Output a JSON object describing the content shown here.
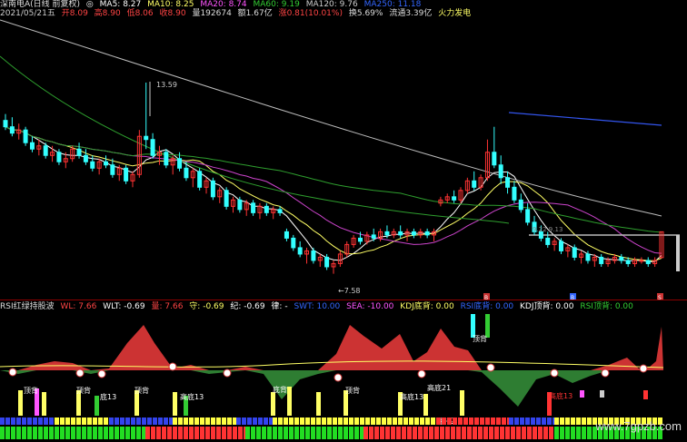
{
  "main_header": {
    "title": "深南电A(日线 前复权)",
    "ma": [
      {
        "label": "MA5: 8.27",
        "color": "#ffffff"
      },
      {
        "label": "MA10: 8.25",
        "color": "#ffff66"
      },
      {
        "label": "MA20: 8.74",
        "color": "#ff55ff"
      },
      {
        "label": "MA60: 9.19",
        "color": "#33cc33"
      },
      {
        "label": "MA120: 9.76",
        "color": "#cccccc"
      },
      {
        "label": "MA250: 11.18",
        "color": "#3366ff"
      }
    ]
  },
  "quote_line": {
    "date": "2021/05/21五",
    "open": "开8.09",
    "high": "高8.90",
    "low": "低8.06",
    "close": "收8.90",
    "volume": "量192674",
    "amount": "额1.67亿",
    "change": "涨0.81(10.01%)",
    "turnover": "换5.69%",
    "float_cap": "流通3.39亿",
    "tag": "火力发电"
  },
  "price_annotations": {
    "high_label": "13.59",
    "low_label": "7.58",
    "ref_label": "9.22 9.13"
  },
  "lower_header": {
    "items": [
      {
        "label": "RSI红绿持股波",
        "color": "#dddddd"
      },
      {
        "label": "WL: 7.66",
        "color": "#ff4444"
      },
      {
        "label": "WLT: -0.69",
        "color": "#ffffff"
      },
      {
        "label": "量: 7.66",
        "color": "#ff4444"
      },
      {
        "label": "守: -0.69",
        "color": "#ffff66"
      },
      {
        "label": "纪: -0.69",
        "color": "#ffffff"
      },
      {
        "label": "律: -",
        "color": "#ffffff"
      },
      {
        "label": "SWT: 10.00",
        "color": "#3366ff"
      },
      {
        "label": "SEA: -10.00",
        "color": "#ff55ff"
      },
      {
        "label": "KDJ底背: 0.00",
        "color": "#ffff66"
      },
      {
        "label": "RSI底背: 0.00",
        "color": "#3366ff"
      },
      {
        "label": "KDJ顶背: 0.00",
        "color": "#ffffff"
      },
      {
        "label": "RSI顶背: 0.00",
        "color": "#33cc33"
      }
    ]
  },
  "indicator_labels": {
    "ding_bei": "顶背",
    "di_bei": "底背",
    "di_13": "底13",
    "gao_di_13": "高底13",
    "gao_di_21": "高底21",
    "chi_gu": "持股",
    "marker_b": "B",
    "marker_s": "S"
  },
  "watermark": "www.7gpzb.com",
  "colors": {
    "up": "#ff3333",
    "down": "#33ffff",
    "bg": "#000000",
    "red_fill": "#cc3333",
    "green_fill": "#2e7d32"
  },
  "chart_data": {
    "type": "candlestick",
    "price_range": [
      7.0,
      15.5
    ],
    "candles": [
      [
        12.4,
        12.6,
        12.1,
        12.2
      ],
      [
        12.2,
        12.5,
        11.9,
        12.0
      ],
      [
        12.0,
        12.3,
        11.8,
        12.1
      ],
      [
        12.1,
        12.2,
        11.6,
        11.7
      ],
      [
        11.7,
        11.9,
        11.4,
        11.5
      ],
      [
        11.5,
        11.8,
        11.3,
        11.6
      ],
      [
        11.6,
        11.7,
        11.2,
        11.3
      ],
      [
        11.3,
        11.6,
        11.1,
        11.4
      ],
      [
        11.4,
        11.5,
        11.0,
        11.1
      ],
      [
        11.1,
        11.4,
        10.9,
        11.2
      ],
      [
        11.2,
        11.6,
        11.1,
        11.5
      ],
      [
        11.5,
        11.7,
        11.2,
        11.3
      ],
      [
        11.3,
        11.5,
        11.0,
        11.1
      ],
      [
        11.1,
        11.3,
        10.8,
        10.9
      ],
      [
        10.9,
        11.2,
        10.7,
        11.1
      ],
      [
        11.1,
        11.3,
        10.9,
        11.0
      ],
      [
        11.0,
        11.2,
        10.6,
        10.7
      ],
      [
        10.7,
        11.0,
        10.5,
        10.9
      ],
      [
        10.9,
        11.0,
        10.4,
        10.5
      ],
      [
        10.5,
        10.8,
        10.3,
        10.7
      ],
      [
        10.7,
        12.1,
        10.6,
        11.9
      ],
      [
        11.9,
        13.59,
        11.5,
        11.8
      ],
      [
        11.8,
        12.0,
        11.2,
        11.3
      ],
      [
        11.3,
        11.6,
        11.0,
        11.4
      ],
      [
        11.4,
        11.5,
        10.9,
        11.0
      ],
      [
        11.0,
        11.3,
        10.7,
        11.2
      ],
      [
        11.2,
        11.4,
        10.8,
        10.9
      ],
      [
        10.9,
        11.1,
        10.5,
        10.6
      ],
      [
        10.6,
        10.9,
        10.3,
        10.8
      ],
      [
        10.8,
        10.9,
        10.2,
        10.3
      ],
      [
        10.3,
        10.6,
        10.1,
        10.5
      ],
      [
        10.5,
        10.6,
        9.9,
        10.0
      ],
      [
        10.0,
        10.3,
        9.8,
        10.2
      ],
      [
        10.2,
        10.3,
        9.6,
        9.7
      ],
      [
        9.7,
        10.0,
        9.5,
        9.9
      ],
      [
        9.9,
        10.0,
        9.5,
        9.6
      ],
      [
        9.6,
        9.9,
        9.4,
        9.8
      ],
      [
        9.8,
        9.9,
        9.4,
        9.5
      ],
      [
        9.5,
        9.8,
        9.3,
        9.7
      ],
      [
        9.7,
        9.8,
        9.4,
        9.5
      ],
      [
        9.5,
        9.7,
        9.3,
        9.6
      ],
      [
        9.6,
        9.7,
        9.4,
        9.5
      ],
      [
        8.9,
        9.0,
        8.6,
        8.7
      ],
      [
        8.7,
        8.8,
        8.3,
        8.4
      ],
      [
        8.4,
        8.6,
        8.1,
        8.2
      ],
      [
        8.2,
        8.4,
        7.9,
        8.3
      ],
      [
        8.3,
        8.4,
        7.9,
        8.0
      ],
      [
        8.0,
        8.2,
        7.8,
        8.1
      ],
      [
        8.1,
        8.2,
        7.7,
        7.8
      ],
      [
        7.8,
        8.0,
        7.58,
        7.9
      ],
      [
        7.9,
        8.3,
        7.8,
        8.2
      ],
      [
        8.2,
        8.6,
        8.1,
        8.5
      ],
      [
        8.5,
        8.8,
        8.4,
        8.7
      ],
      [
        8.7,
        8.9,
        8.5,
        8.6
      ],
      [
        8.6,
        8.9,
        8.5,
        8.8
      ],
      [
        8.8,
        9.0,
        8.6,
        8.7
      ],
      [
        8.7,
        9.0,
        8.6,
        8.9
      ],
      [
        8.9,
        9.1,
        8.7,
        8.8
      ],
      [
        8.8,
        9.0,
        8.7,
        8.9
      ],
      [
        8.9,
        9.1,
        8.7,
        8.8
      ],
      [
        8.8,
        9.0,
        8.6,
        8.9
      ],
      [
        8.9,
        9.0,
        8.7,
        8.8
      ],
      [
        8.8,
        9.0,
        8.7,
        8.9
      ],
      [
        8.9,
        9.0,
        8.7,
        8.8
      ],
      [
        8.8,
        9.0,
        8.6,
        8.9
      ],
      [
        9.8,
        10.0,
        9.7,
        9.9
      ],
      [
        9.9,
        10.1,
        9.8,
        10.0
      ],
      [
        10.0,
        10.2,
        9.8,
        9.9
      ],
      [
        9.9,
        10.3,
        9.8,
        10.2
      ],
      [
        10.2,
        10.6,
        10.1,
        10.5
      ],
      [
        10.5,
        10.8,
        10.2,
        10.3
      ],
      [
        10.3,
        10.7,
        10.2,
        10.6
      ],
      [
        10.6,
        11.8,
        10.5,
        11.4
      ],
      [
        11.4,
        12.2,
        10.9,
        11.0
      ],
      [
        11.0,
        11.3,
        10.4,
        10.6
      ],
      [
        10.6,
        10.8,
        10.1,
        10.3
      ],
      [
        10.3,
        10.5,
        9.8,
        9.9
      ],
      [
        9.9,
        10.1,
        9.5,
        9.6
      ],
      [
        9.6,
        9.8,
        9.1,
        9.2
      ],
      [
        9.2,
        9.4,
        8.8,
        8.9
      ],
      [
        8.9,
        9.1,
        8.6,
        8.7
      ],
      [
        8.7,
        8.9,
        8.4,
        8.5
      ],
      [
        8.5,
        8.7,
        8.3,
        8.6
      ],
      [
        8.6,
        8.7,
        8.2,
        8.3
      ],
      [
        8.3,
        8.5,
        8.1,
        8.4
      ],
      [
        8.4,
        8.5,
        8.0,
        8.1
      ],
      [
        8.1,
        8.3,
        7.9,
        8.2
      ],
      [
        8.2,
        8.3,
        7.9,
        8.0
      ],
      [
        8.0,
        8.2,
        7.8,
        8.1
      ],
      [
        8.1,
        8.2,
        7.8,
        7.9
      ],
      [
        7.9,
        8.1,
        7.8,
        8.0
      ],
      [
        8.0,
        8.2,
        7.9,
        8.1
      ],
      [
        8.1,
        8.2,
        7.9,
        8.0
      ],
      [
        8.0,
        8.1,
        7.8,
        7.9
      ],
      [
        7.9,
        8.1,
        7.8,
        8.0
      ],
      [
        8.0,
        8.1,
        7.9,
        8.0
      ],
      [
        8.0,
        8.1,
        7.8,
        7.9
      ],
      [
        7.9,
        8.1,
        7.8,
        8.0
      ],
      [
        8.09,
        8.9,
        8.06,
        8.9
      ]
    ]
  }
}
